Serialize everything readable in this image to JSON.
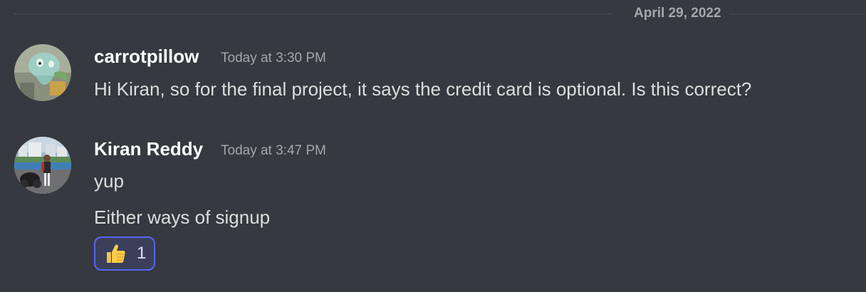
{
  "date_divider": "April 29, 2022",
  "messages": [
    {
      "author": "carrotpillow",
      "timestamp": "Today at 3:30 PM",
      "avatar_icon": "squid-character-avatar",
      "lines": [
        "Hi Kiran, so for the final project, it says the credit card is optional. Is this correct?"
      ]
    },
    {
      "author": "Kiran Reddy",
      "timestamp": "Today at 3:47 PM",
      "avatar_icon": "person-with-motorcycle-avatar",
      "lines": [
        "yup",
        "Either ways of signup"
      ],
      "reaction": {
        "emoji": "thumbs-up-icon",
        "count": "1"
      }
    }
  ],
  "colors": {
    "background": "#36393f",
    "author": "#ffffff",
    "text": "#dcddde",
    "muted": "#a3a6aa",
    "reaction_border": "#5865f2",
    "reaction_bg": "#3b405a"
  }
}
